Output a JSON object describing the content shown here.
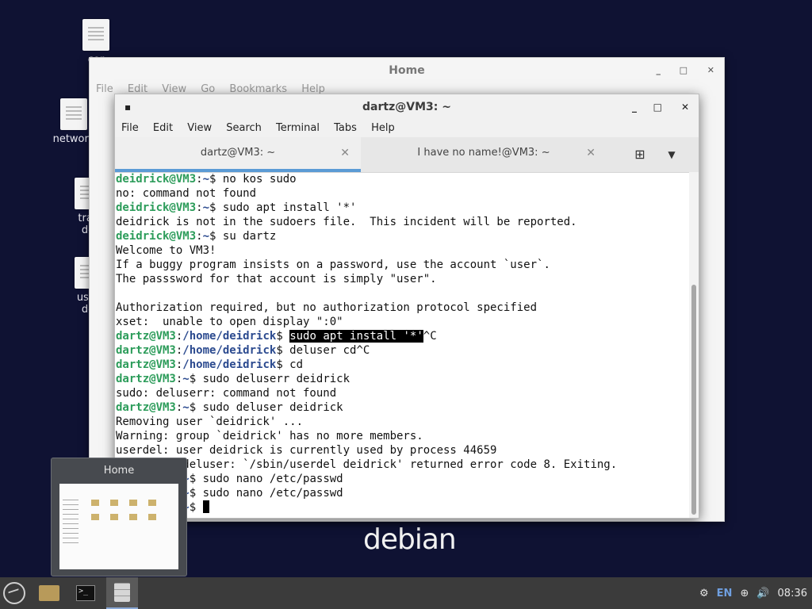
{
  "desktop": {
    "icons": [
      {
        "label_top": "cor",
        "label_bottom": "de"
      },
      {
        "label_top": "network"
      },
      {
        "label_top": "tras",
        "label_bottom": "de"
      },
      {
        "label_top": "user",
        "label_bottom": "de"
      }
    ],
    "logo_text": "debian"
  },
  "home_window": {
    "title": "Home",
    "menu": [
      "File",
      "Edit",
      "View",
      "Go",
      "Bookmarks",
      "Help"
    ]
  },
  "terminal": {
    "title": "dartz@VM3: ~",
    "menu": [
      "File",
      "Edit",
      "View",
      "Search",
      "Terminal",
      "Tabs",
      "Help"
    ],
    "tabs": [
      {
        "label": "dartz@VM3: ~",
        "active": true
      },
      {
        "label": "I have no name!@VM3: ~",
        "active": false
      }
    ],
    "lines": [
      {
        "user": "deidrick@VM3",
        "path": "~",
        "cmd": " no kos sudo"
      },
      {
        "text": "no: command not found"
      },
      {
        "user": "deidrick@VM3",
        "path": "~",
        "cmd": " sudo apt install '*'"
      },
      {
        "text": "deidrick is not in the sudoers file.  This incident will be reported."
      },
      {
        "user": "deidrick@VM3",
        "path": "~",
        "cmd": " su dartz"
      },
      {
        "text": "Welcome to VM3!"
      },
      {
        "text": "If a buggy program insists on a password, use the account `user`."
      },
      {
        "text": "The passsword for that account is simply \"user\"."
      },
      {
        "text": ""
      },
      {
        "text": "Authorization required, but no authorization protocol specified"
      },
      {
        "text": "xset:  unable to open display \":0\""
      },
      {
        "user": "dartz@VM3",
        "path": "/home/deidrick",
        "selected": "sudo apt install '*'",
        "cmd": "^C"
      },
      {
        "user": "dartz@VM3",
        "path": "/home/deidrick",
        "cmd": " deluser cd^C"
      },
      {
        "user": "dartz@VM3",
        "path": "/home/deidrick",
        "cmd": " cd"
      },
      {
        "user": "dartz@VM3",
        "path": "~",
        "cmd": " sudo deluserr deidrick"
      },
      {
        "text": "sudo: deluserr: command not found"
      },
      {
        "user": "dartz@VM3",
        "path": "~",
        "cmd": " sudo deluser deidrick"
      },
      {
        "text": "Removing user `deidrick' ..."
      },
      {
        "text": "Warning: group `deidrick' has no more members."
      },
      {
        "text": "userdel: user deidrick is currently used by process 44659"
      },
      {
        "text": "/usr/sbin/deluser: `/sbin/userdel deidrick' returned error code 8. Exiting."
      },
      {
        "user": "dartz@VM3",
        "path": "~",
        "cmd": " sudo nano /etc/passwd"
      },
      {
        "user": "dartz@VM3",
        "path": "~",
        "cmd": " sudo nano /etc/passwd"
      },
      {
        "user": "dartz@VM3",
        "path": "~",
        "cmd": " ",
        "cursor": true
      }
    ]
  },
  "preview": {
    "title": "Home"
  },
  "panel": {
    "tasks": [
      "folder-icon",
      "terminal-icon",
      "file-cabinet-icon"
    ],
    "tray": {
      "language": "EN",
      "clock": "08:36"
    }
  }
}
